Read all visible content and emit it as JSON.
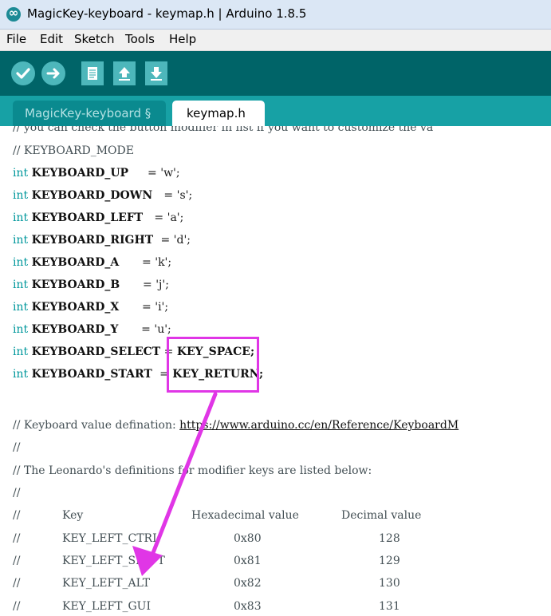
{
  "window": {
    "title": "MagicKey-keyboard - keymap.h | Arduino 1.8.5"
  },
  "menu": {
    "items": [
      "File",
      "Edit",
      "Sketch",
      "Tools",
      "Help"
    ]
  },
  "tabs": [
    {
      "label": "MagicKey-keyboard §"
    },
    {
      "label": "keymap.h"
    }
  ],
  "code": {
    "partial_top": "// you can check the button modifier in list if you want to customize the va",
    "mode_comment": "// KEYBOARD_MODE",
    "keyword": "int",
    "definitions": [
      {
        "name": "KEYBOARD_UP    ",
        "eq": " = ",
        "value": "'w';"
      },
      {
        "name": "KEYBOARD_DOWN  ",
        "eq": " = ",
        "value": "'s';"
      },
      {
        "name": "KEYBOARD_LEFT  ",
        "eq": " = ",
        "value": "'a';"
      },
      {
        "name": "KEYBOARD_RIGHT ",
        "eq": " = ",
        "value": "'d';"
      },
      {
        "name": "KEYBOARD_A     ",
        "eq": " = ",
        "value": "'k';"
      },
      {
        "name": "KEYBOARD_B     ",
        "eq": " = ",
        "value": "'j';"
      },
      {
        "name": "KEYBOARD_X     ",
        "eq": " = ",
        "value": "'i';"
      },
      {
        "name": "KEYBOARD_Y     ",
        "eq": " = ",
        "value": "'u';"
      },
      {
        "name": "KEYBOARD_SELECT",
        "eq": " = ",
        "value": "KEY_SPACE;"
      },
      {
        "name": "KEYBOARD_START ",
        "eq": " = ",
        "value": "KEY_RETURN;"
      }
    ],
    "value_def_comment": "// Keyboard value defination: ",
    "value_def_url": "https://www.arduino.cc/en/Reference/KeyboardM",
    "empty_comment": "//",
    "leonardo_comment": "// The Leonardo's definitions for modifier keys are listed below:",
    "table_header": {
      "prefix": "//",
      "key": "Key",
      "hex": "Hexadecimal value",
      "dec": "Decimal value"
    },
    "table_rows": [
      {
        "prefix": "//",
        "key": "KEY_LEFT_CTRL",
        "hex": "0x80",
        "dec": "128"
      },
      {
        "prefix": "//",
        "key": "KEY_LEFT_SHIFT",
        "hex": "0x81",
        "dec": "129"
      },
      {
        "prefix": "//",
        "key": "KEY_LEFT_ALT",
        "hex": "0x82",
        "dec": "130"
      },
      {
        "prefix": "//",
        "key": "KEY_LEFT_GUI",
        "hex": "0x83",
        "dec": "131"
      }
    ]
  },
  "colors": {
    "toolbar_bg": "#006468",
    "tab_strip_bg": "#17a1a5",
    "keyword": "#00979c",
    "highlight_annotation": "#e036e6"
  }
}
